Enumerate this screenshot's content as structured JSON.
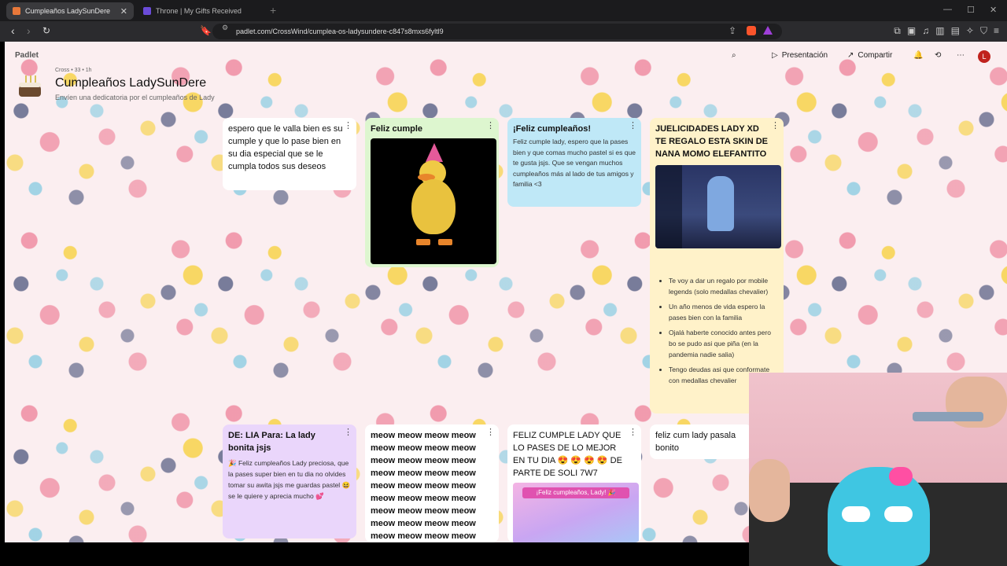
{
  "browser": {
    "tabs": [
      {
        "label": "Cumpleaños LadySunDere",
        "active": true,
        "favicon_color": "#e8783a"
      },
      {
        "label": "Throne | My Gifts Received",
        "active": false,
        "favicon_color": "#6a4bd8"
      }
    ],
    "url": "padlet.com/CrossWind/cumplea-os-ladysundere-c847s8mxs6fyltl9",
    "close_symbol": "✕",
    "new_tab_symbol": "+"
  },
  "padlet": {
    "brand": "Padlet",
    "meta": "Cross • 33 • 1h",
    "title": "Cumpleaños LadySunDere",
    "subtitle": "Envíen una dedicatoria por el cumpleaños de Lady",
    "actions": {
      "presentation": "Presentación",
      "share": "Compartir"
    },
    "avatar_letter": "L"
  },
  "cards": {
    "c1": {
      "body": "espero que le valla bien es su cumple y que lo pase bien en su dia especial que se le cumpla todos sus deseos"
    },
    "c2": {
      "head": "Feliz cumple"
    },
    "c3": {
      "head": "¡Feliz cumpleaños!",
      "body": "Feliz cumple lady, espero que la pases bien y que comas mucho pastel si es que te gusta jsjs. Que se vengan muchos cumpleaños más al lado de tus amigos y familia <3"
    },
    "c4": {
      "head": "JUELICIDADES LADY XD TE REGALO ESTA SKIN DE NANA MOMO ELEFANTITO",
      "bullets": [
        "Te voy a dar un regalo por mobile legends (solo medallas chevalier)",
        "Un año menos de vida espero la pases bien con la familia",
        "Ojalá haberte conocido antes pero bo se pudo asi que piña (en la pandemia nadie salia)",
        "Tengo deudas asi que conformate con medallas chevalier"
      ]
    },
    "c5": {
      "head": "DE: LIA Para: La lady bonita jsjs",
      "body": "🎉 Feliz cumpleaños Lady preciosa, que la pases super bien en tu dia no olvides tomar su awita jsjs me guardas pastel 😆 se le quiere y aprecia mucho 💕"
    },
    "c6": {
      "body": "meow meow meow meow meow meow meow meow meow meow meow meow meow meow meow meow meow meow meow meow meow meow meow meow meow meow meow meow meow meow meow meow meow meow meow meow"
    },
    "c7": {
      "head": "FELIZ CUMPLE LADY QUE LO PASES DE LO MEJOR EN TU DIA 😍 😍 😍 😍 DE PARTE DE SOLI 7W7",
      "banner": "¡Feliz cumpleaños, Lady! 🎉"
    },
    "c8": {
      "body": "feliz cum lady pasala bonito"
    }
  },
  "colors": {
    "card_green": "#ddf6cf",
    "card_blue": "#bfe8f7",
    "card_yellow": "#fff2c9",
    "card_purple": "#ead6fb",
    "avatar": "#c0221d"
  }
}
